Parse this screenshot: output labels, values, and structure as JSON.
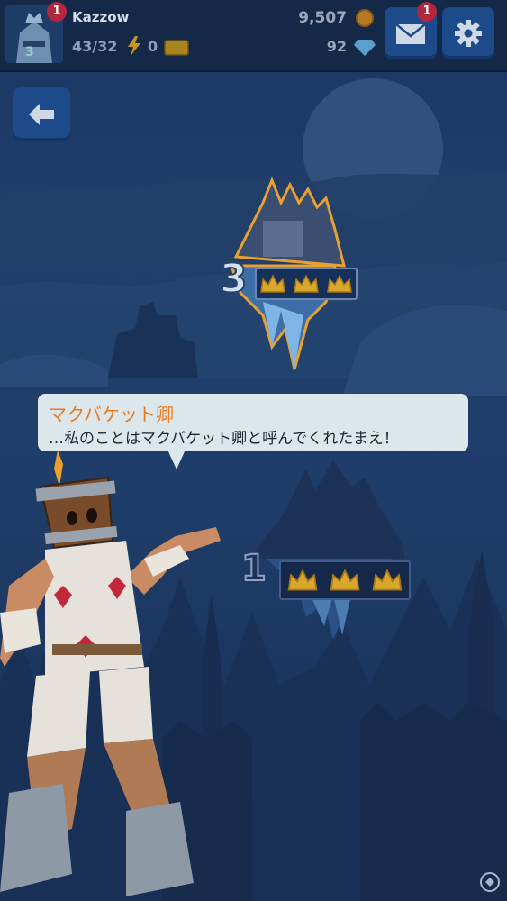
{
  "header": {
    "player_name": "Kazzow",
    "level": "3",
    "avatar_badge": "1",
    "energy": "43/32",
    "tickets": "0",
    "coins": "9,507",
    "gems": "92",
    "mail_badge": "1"
  },
  "map": {
    "stages": [
      {
        "number": "3",
        "crowns": 3,
        "crown_icons": [
          "crown-icon",
          "crown-icon",
          "crown-icon"
        ]
      },
      {
        "number": "1",
        "crowns": 3,
        "crown_icons": [
          "crown-icon",
          "crown-icon",
          "crown-icon"
        ]
      }
    ]
  },
  "dialog": {
    "speaker": "マクバケット卿",
    "text": "…私のことはマクバケット卿と呼んでくれたまえ！"
  },
  "icons": {
    "avatar": "knight-avatar-icon",
    "energy": "lightning-icon",
    "tickets": "ticket-icon",
    "coins": "coin-icon",
    "gems": "gem-icon",
    "mail": "mail-icon",
    "settings": "gear-icon",
    "back": "back-arrow-icon",
    "watermark": "watermark-icon"
  },
  "colors": {
    "accent_orange": "#e87a20",
    "button_blue": "#1d4a8a",
    "crown_gold": "#d8a72c",
    "badge_red": "#b3263c"
  }
}
